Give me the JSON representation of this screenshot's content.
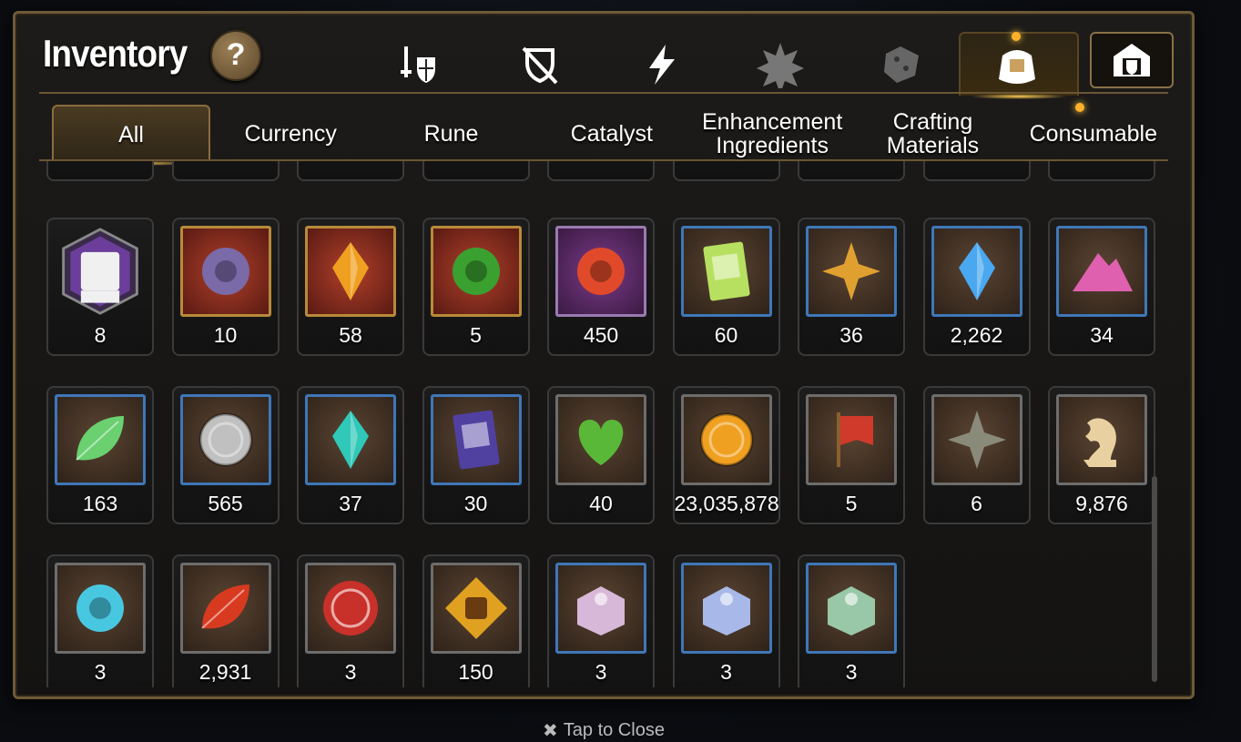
{
  "header": {
    "title": "Inventory",
    "help_label": "?"
  },
  "categories": [
    {
      "icon": "sword-shield-icon",
      "active": false
    },
    {
      "icon": "crossed-shield-icon",
      "active": false
    },
    {
      "icon": "lightning-icon",
      "active": false
    },
    {
      "icon": "burst-icon",
      "active": false
    },
    {
      "icon": "dice-icon",
      "active": false
    },
    {
      "icon": "bag-icon",
      "active": true
    },
    {
      "icon": "storage-icon",
      "active": false
    }
  ],
  "tabs": [
    {
      "label": "All",
      "active": true
    },
    {
      "label": "Currency",
      "active": false
    },
    {
      "label": "Rune",
      "active": false
    },
    {
      "label": "Catalyst",
      "active": false
    },
    {
      "label": "Enhancement\nIngredients",
      "active": false
    },
    {
      "label": "Crafting\nMaterials",
      "active": false
    },
    {
      "label": "Consumable",
      "active": false
    }
  ],
  "items": [
    {
      "name": "pet-card-icon",
      "qty": "8",
      "frame": "none",
      "color": "#6a3e9a"
    },
    {
      "name": "purple-rune-icon",
      "qty": "10",
      "frame": "gold",
      "color": "#7a6aa8"
    },
    {
      "name": "amber-crystal-icon",
      "qty": "58",
      "frame": "gold",
      "color": "#f0a020"
    },
    {
      "name": "clover-charm-icon",
      "qty": "5",
      "frame": "gold",
      "color": "#3aa030"
    },
    {
      "name": "red-rune-ring-icon",
      "qty": "450",
      "frame": "purple",
      "color": "#e04a2a"
    },
    {
      "name": "recipe-card-icon",
      "qty": "60",
      "frame": "blue",
      "color": "#b8e060"
    },
    {
      "name": "compass-charm-icon",
      "qty": "36",
      "frame": "blue",
      "color": "#e0a030"
    },
    {
      "name": "blue-gem-icon",
      "qty": "2,262",
      "frame": "blue",
      "color": "#4aa8f0"
    },
    {
      "name": "pink-powder-icon",
      "qty": "34",
      "frame": "blue",
      "color": "#e060b0"
    },
    {
      "name": "green-leaf-icon",
      "qty": "163",
      "frame": "blue",
      "color": "#6ad070"
    },
    {
      "name": "silver-coin-icon",
      "qty": "565",
      "frame": "blue",
      "color": "#c0c0c0"
    },
    {
      "name": "teal-crystal-icon",
      "qty": "37",
      "frame": "blue",
      "color": "#30c8b8"
    },
    {
      "name": "purple-book-icon",
      "qty": "30",
      "frame": "blue",
      "color": "#5040a0"
    },
    {
      "name": "green-heart-icon",
      "qty": "40",
      "frame": "plain",
      "color": "#5ab838"
    },
    {
      "name": "gold-coin-icon",
      "qty": "23,035,878",
      "frame": "plain",
      "color": "#f0a020"
    },
    {
      "name": "banner-icon",
      "qty": "5",
      "frame": "plain",
      "color": "#d03a2a"
    },
    {
      "name": "stone-compass-icon",
      "qty": "6",
      "frame": "plain",
      "color": "#8a8a7a"
    },
    {
      "name": "knight-piece-icon",
      "qty": "9,876",
      "frame": "plain",
      "color": "#e8d0a0"
    },
    {
      "name": "robot-orb-icon",
      "qty": "3",
      "frame": "plain",
      "color": "#48c8e0"
    },
    {
      "name": "red-leaf-icon",
      "qty": "2,931",
      "frame": "plain",
      "color": "#d83a20"
    },
    {
      "name": "red-seal-icon",
      "qty": "3",
      "frame": "plain",
      "color": "#c8302a"
    },
    {
      "name": "fist-emblem-icon",
      "qty": "150",
      "frame": "plain",
      "color": "#e0a020"
    },
    {
      "name": "ruby-chest-icon",
      "qty": "3",
      "frame": "blue",
      "color": "#d8b8d8"
    },
    {
      "name": "sapphire-chest-icon",
      "qty": "3",
      "frame": "blue",
      "color": "#a8b8e8"
    },
    {
      "name": "emerald-chest-icon",
      "qty": "3",
      "frame": "blue",
      "color": "#98c8a8"
    }
  ],
  "footer": {
    "close_icon": "✖",
    "close_label": "Tap to Close"
  }
}
